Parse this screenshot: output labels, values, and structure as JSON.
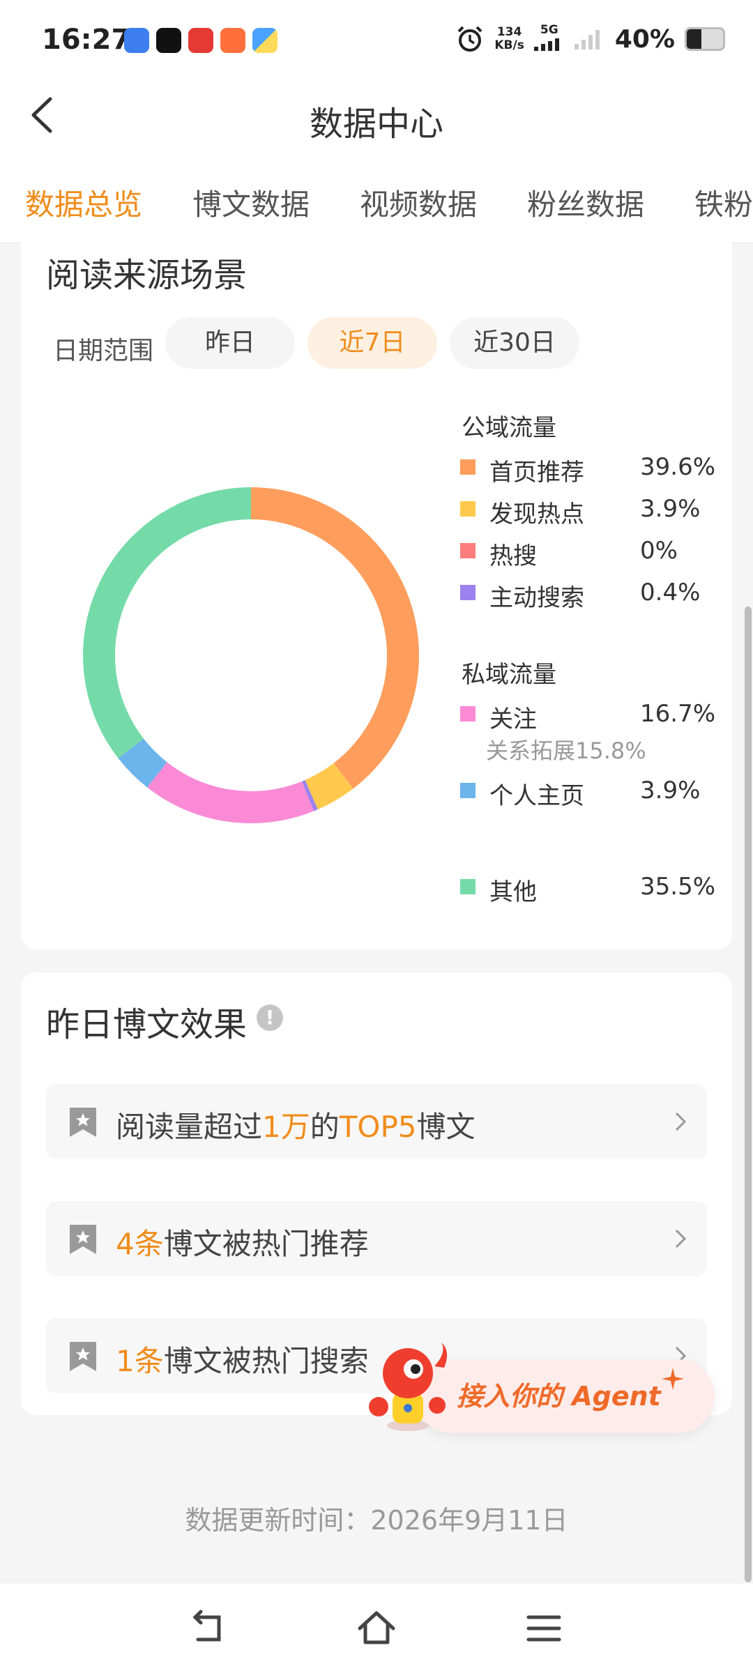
{
  "status_bar": {
    "time": "16:27",
    "apps": [
      "blue-app-icon",
      "tiktok-icon",
      "red-app-icon",
      "orange-app-icon",
      "blue-yellow-app-icon"
    ],
    "alarm_icon": "alarm-icon",
    "net_speed": "134",
    "net_unit": "KB/s",
    "network": "5G",
    "battery": "40%"
  },
  "header": {
    "title": "数据中心"
  },
  "tabs": [
    "数据总览",
    "博文数据",
    "视频数据",
    "粉丝数据",
    "铁粉"
  ],
  "read_source": {
    "title": "阅读来源场景",
    "range_label": "日期范围",
    "ranges": [
      "昨日",
      "近7日",
      "近30日"
    ],
    "selected_range": "近7日",
    "public_label": "公域流量",
    "private_label": "私域流量",
    "sub_note": "关系拓展15.8%"
  },
  "chart_data": {
    "type": "pie",
    "style": "donut",
    "slices": [
      {
        "name": "首页推荐",
        "value": 39.6,
        "label": "39.6%",
        "color": "#ff9d5c"
      },
      {
        "name": "发现热点",
        "value": 3.9,
        "label": "3.9%",
        "color": "#ffc94d"
      },
      {
        "name": "热搜",
        "value": 0,
        "label": "0%",
        "color": "#fb7d7d"
      },
      {
        "name": "主动搜索",
        "value": 0.4,
        "label": "0.4%",
        "color": "#9b82f0"
      },
      {
        "name": "关注",
        "value": 16.7,
        "label": "16.7%",
        "color": "#fb8ad6"
      },
      {
        "name": "个人主页",
        "value": 3.9,
        "label": "3.9%",
        "color": "#6cb4ec"
      },
      {
        "name": "其他",
        "value": 35.5,
        "label": "35.5%",
        "color": "#74dba8"
      }
    ]
  },
  "yesterday": {
    "title": "昨日博文效果",
    "rows": [
      {
        "p1": "阅读量超过",
        "h1": "1万",
        "p2": "的",
        "h2": "TOP5",
        "p3": "博文"
      },
      {
        "h1": "4条",
        "p1": "博文被热门推荐"
      },
      {
        "h1": "1条",
        "p1": "博文被热门搜索"
      }
    ]
  },
  "agent": {
    "label": "接入你的 Agent"
  },
  "footer": {
    "update_time": "数据更新时间：2026年9月11日"
  }
}
